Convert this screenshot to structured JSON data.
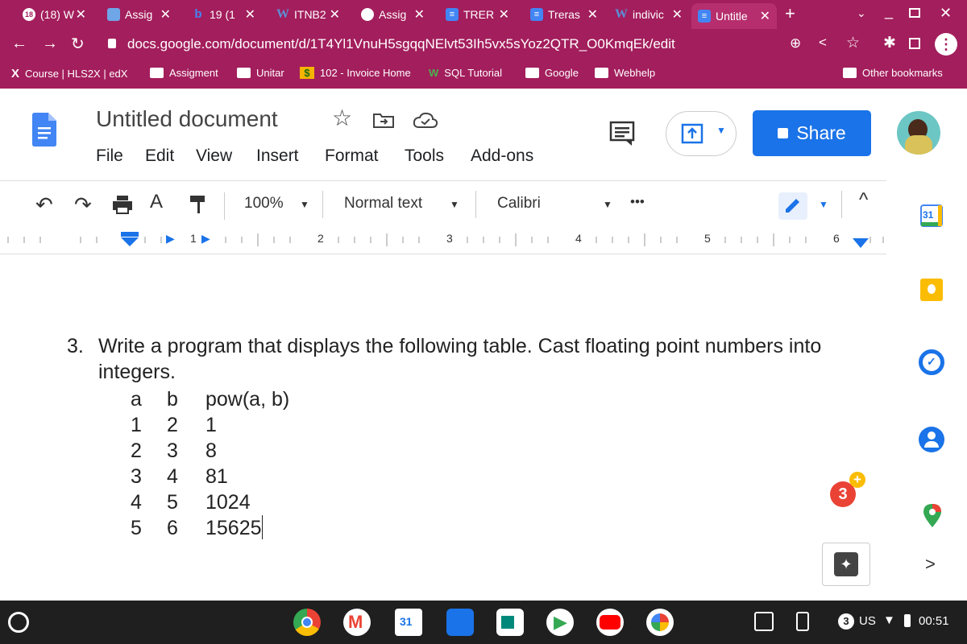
{
  "tabs": [
    {
      "label": "(18) W",
      "favicon": "18",
      "active": false
    },
    {
      "label": "Assig",
      "favicon": "",
      "active": false
    },
    {
      "label": "19 (1",
      "favicon": "b",
      "active": false
    },
    {
      "label": "ITNB2",
      "favicon": "W",
      "active": false
    },
    {
      "label": "Assig",
      "favicon": "",
      "active": false
    },
    {
      "label": "TRER",
      "favicon": "",
      "active": false
    },
    {
      "label": "Treras",
      "favicon": "",
      "active": false
    },
    {
      "label": "indivic",
      "favicon": "W",
      "active": false
    },
    {
      "label": "Untitle",
      "favicon": "",
      "active": true
    }
  ],
  "address": {
    "url": "docs.google.com/document/d/1T4Yl1VnuH5sgqqNElvt53Ih5vx5sYoz2QTR_O0KmqEk/edit"
  },
  "bookmarks": [
    {
      "label": "Course | HLS2X | edX",
      "icon": "X"
    },
    {
      "label": "Assigment",
      "icon": "folder-icon"
    },
    {
      "label": "Unitar",
      "icon": "folder-icon"
    },
    {
      "label": "102 - Invoice Home",
      "icon": "$"
    },
    {
      "label": "SQL Tutorial",
      "icon": "W"
    },
    {
      "label": "Google",
      "icon": "folder-icon"
    },
    {
      "label": "Webhelp",
      "icon": "folder-icon"
    }
  ],
  "other_bookmarks": "Other bookmarks",
  "doc": {
    "title": "Untitled document",
    "share_label": "Share",
    "menu": [
      "File",
      "Edit",
      "View",
      "Insert",
      "Format",
      "Tools",
      "Add-ons"
    ]
  },
  "toolbar": {
    "zoom": "100%",
    "style": "Normal text",
    "font": "Calibri",
    "more": "•••"
  },
  "ruler": {
    "numbers": [
      "1",
      "2",
      "3",
      "4",
      "5",
      "6"
    ]
  },
  "content": {
    "number": "3.",
    "line1": "Write a program that displays the following table. Cast floating point numbers into",
    "line2": "integers.",
    "table": {
      "headers": [
        "a",
        "b",
        "pow(a, b)"
      ],
      "rows": [
        [
          "1",
          "2",
          "1"
        ],
        [
          "2",
          "3",
          "8"
        ],
        [
          "3",
          "4",
          "81"
        ],
        [
          "4",
          "5",
          "1024"
        ],
        [
          "5",
          "6",
          "15625"
        ]
      ]
    }
  },
  "side": {
    "calendar_day": "31"
  },
  "notification_count": "3",
  "status": {
    "count": "3",
    "region": "US",
    "time": "00:51"
  },
  "taskbar": {
    "calendar_day": "31"
  },
  "colors": {
    "chrome": "#a31e5c",
    "share": "#1a73e8",
    "docs_blue": "#4285f4"
  }
}
